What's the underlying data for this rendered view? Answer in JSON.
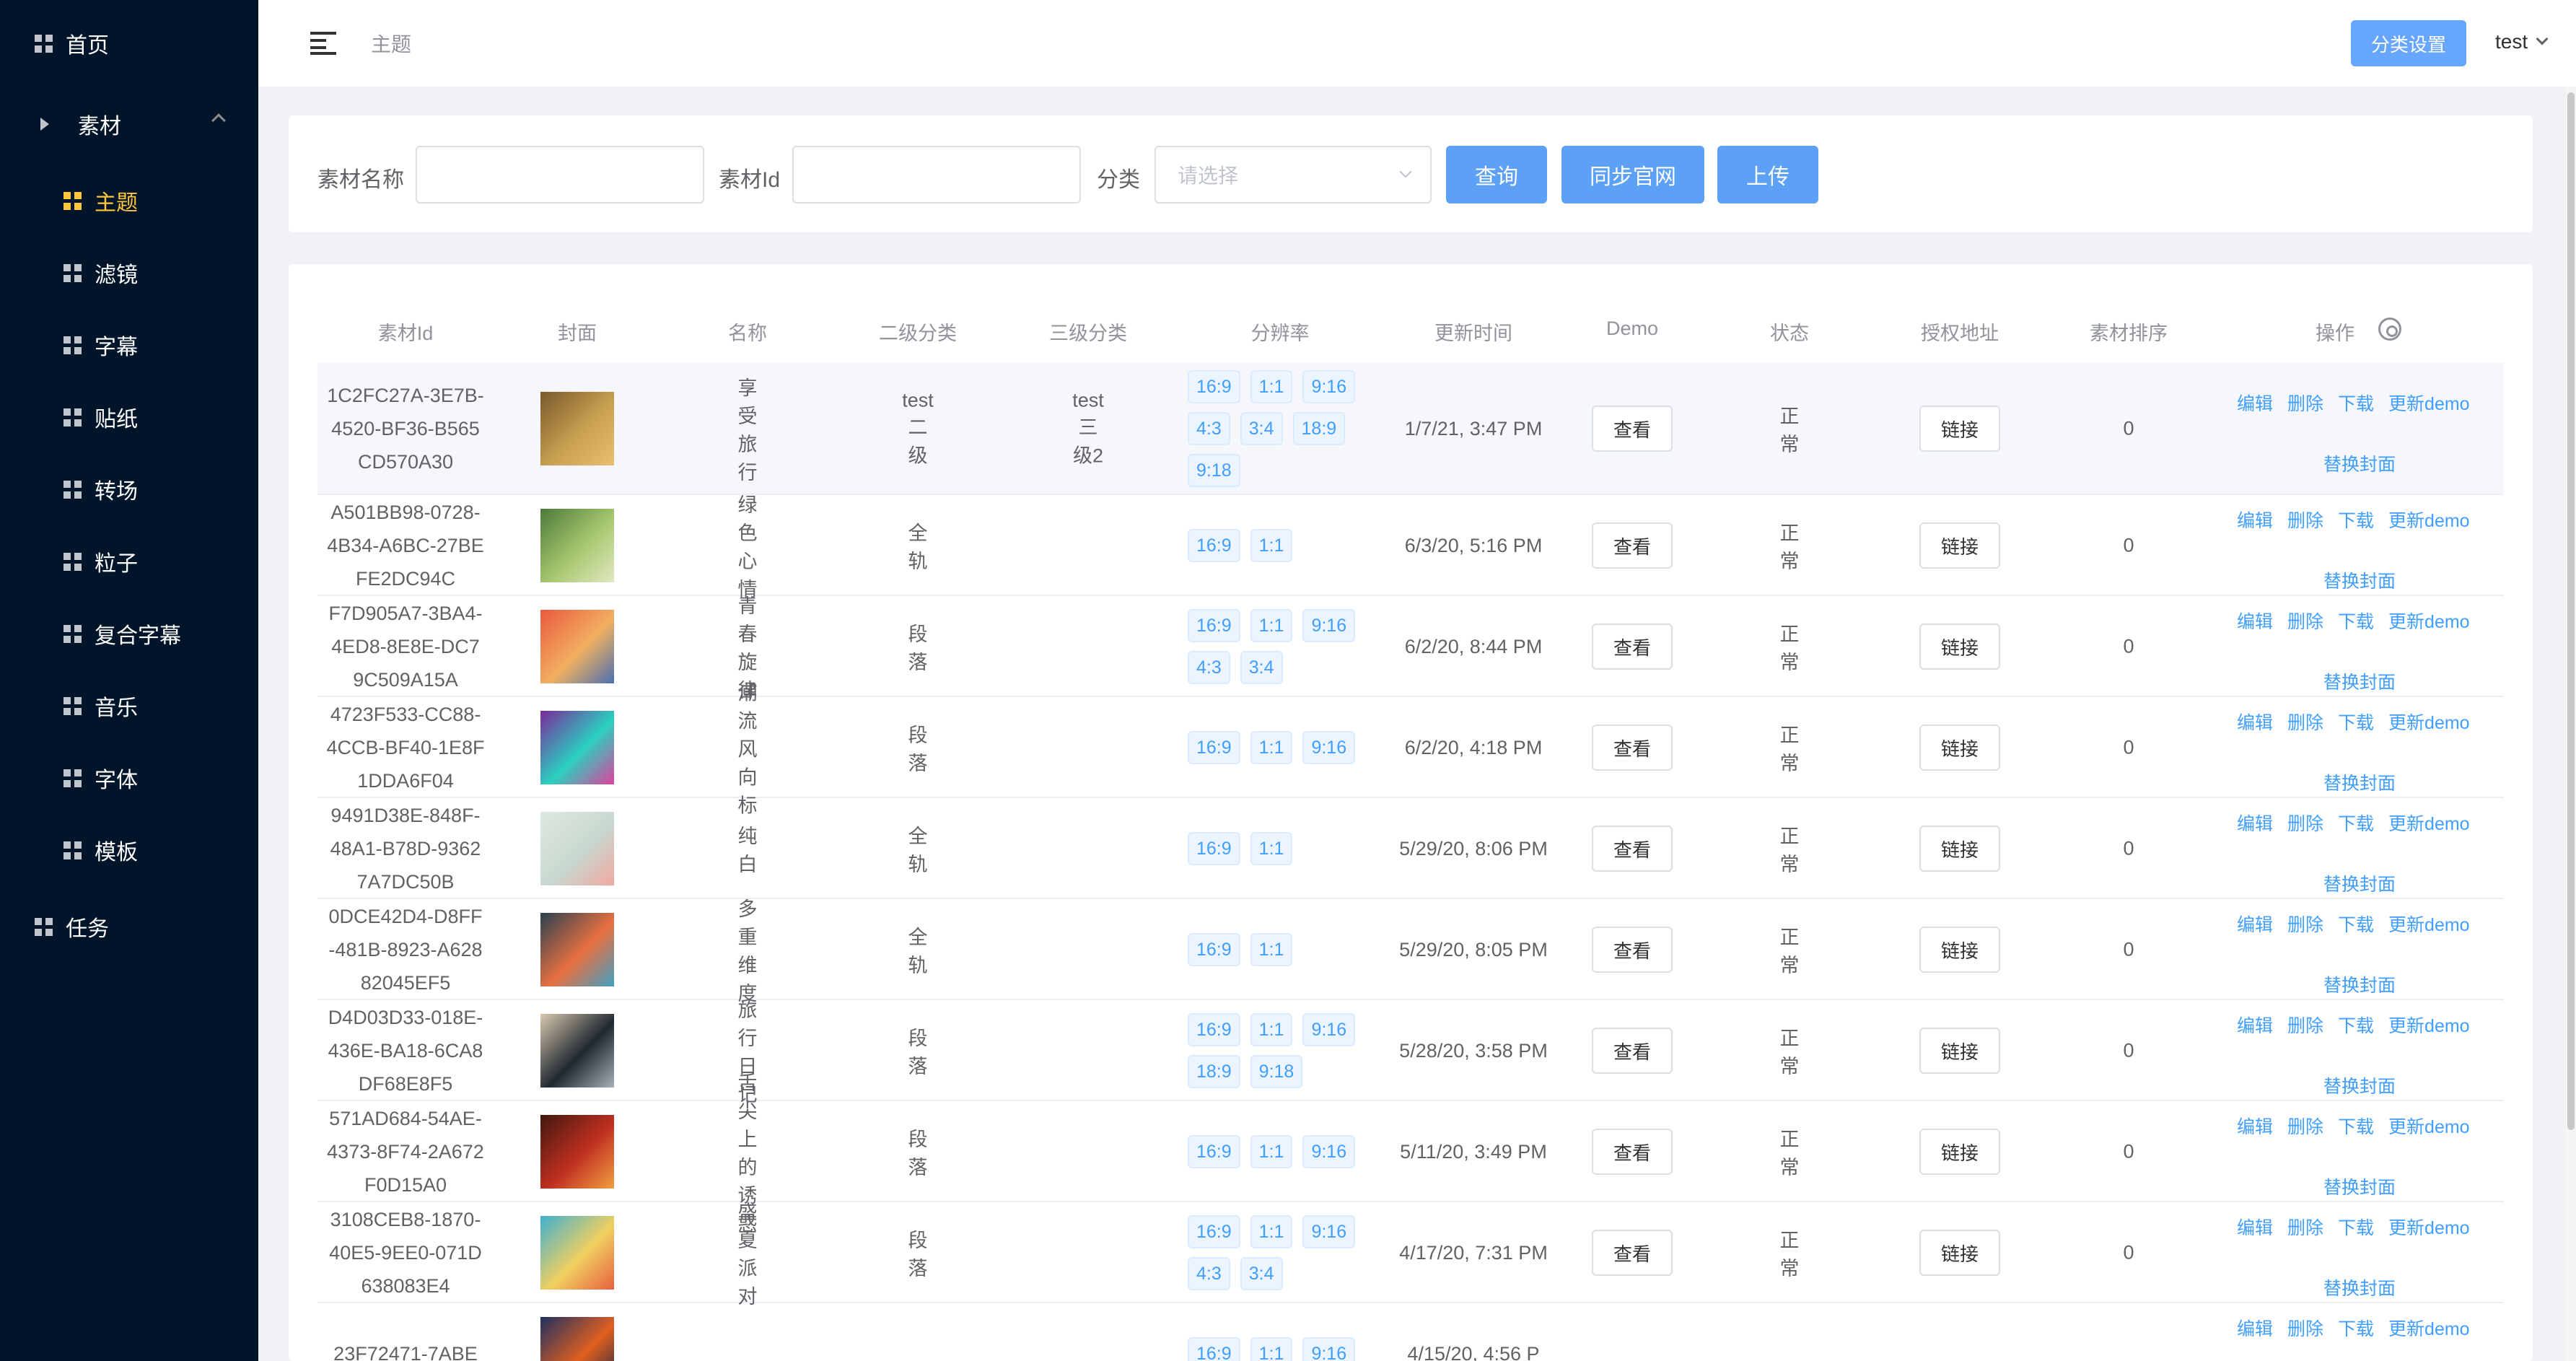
{
  "sidebar": {
    "items": [
      {
        "label": "首页"
      },
      {
        "label": "素材"
      },
      {
        "label": "主题"
      },
      {
        "label": "滤镜"
      },
      {
        "label": "字幕"
      },
      {
        "label": "贴纸"
      },
      {
        "label": "转场"
      },
      {
        "label": "粒子"
      },
      {
        "label": "复合字幕"
      },
      {
        "label": "音乐"
      },
      {
        "label": "字体"
      },
      {
        "label": "模板"
      },
      {
        "label": "任务"
      }
    ]
  },
  "header": {
    "breadcrumb": "主题",
    "category_button": "分类设置",
    "user": "test"
  },
  "search": {
    "name_label": "素材名称",
    "id_label": "素材Id",
    "category_label": "分类",
    "category_placeholder": "请选择",
    "query_button": "查询",
    "sync_button": "同步官网",
    "upload_button": "上传"
  },
  "table": {
    "headers": [
      "素材Id",
      "封面",
      "名称",
      "二级分类",
      "三级分类",
      "分辨率",
      "更新时间",
      "Demo",
      "状态",
      "授权地址",
      "素材排序",
      "操作"
    ],
    "view_label": "查看",
    "link_label": "链接",
    "ops": {
      "edit": "编辑",
      "delete": "删除",
      "download": "下载",
      "update_demo": "更新demo",
      "replace_cover": "替换封面"
    },
    "rows": [
      {
        "id": "1C2FC27A-3E7B-4520-BF36-B565CD570A30",
        "name": "享受旅行",
        "cat2": "test二级",
        "cat3": "test三级2",
        "ratios": [
          "16:9",
          "1:1",
          "9:16",
          "4:3",
          "3:4",
          "18:9",
          "9:18"
        ],
        "time": "1/7/21, 3:47 PM",
        "status": "正常",
        "sort": "0"
      },
      {
        "id": "A501BB98-0728-4B34-A6BC-27BEFE2DC94C",
        "name": "绿色心情",
        "cat2": "全轨",
        "cat3": "",
        "ratios": [
          "16:9",
          "1:1"
        ],
        "time": "6/3/20, 5:16 PM",
        "status": "正常",
        "sort": "0"
      },
      {
        "id": "F7D905A7-3BA4-4ED8-8E8E-DC79C509A15A",
        "name": "青春旋律",
        "cat2": "段落",
        "cat3": "",
        "ratios": [
          "16:9",
          "1:1",
          "9:16",
          "4:3",
          "3:4"
        ],
        "time": "6/2/20, 8:44 PM",
        "status": "正常",
        "sort": "0"
      },
      {
        "id": "4723F533-CC88-4CCB-BF40-1E8F1DDA6F04",
        "name": "潮流风向标",
        "cat2": "段落",
        "cat3": "",
        "ratios": [
          "16:9",
          "1:1",
          "9:16"
        ],
        "time": "6/2/20, 4:18 PM",
        "status": "正常",
        "sort": "0"
      },
      {
        "id": "9491D38E-848F-48A1-B78D-93627A7DC50B",
        "name": "纯白",
        "cat2": "全轨",
        "cat3": "",
        "ratios": [
          "16:9",
          "1:1"
        ],
        "time": "5/29/20, 8:06 PM",
        "status": "正常",
        "sort": "0"
      },
      {
        "id": "0DCE42D4-D8FF-481B-8923-A62882045EF5",
        "name": "多重维度",
        "cat2": "全轨",
        "cat3": "",
        "ratios": [
          "16:9",
          "1:1"
        ],
        "time": "5/29/20, 8:05 PM",
        "status": "正常",
        "sort": "0"
      },
      {
        "id": "D4D03D33-018E-436E-BA18-6CA8DF68E8F5",
        "name": "旅行日记",
        "cat2": "段落",
        "cat3": "",
        "ratios": [
          "16:9",
          "1:1",
          "9:16",
          "18:9",
          "9:18"
        ],
        "time": "5/28/20, 3:58 PM",
        "status": "正常",
        "sort": "0"
      },
      {
        "id": "571AD684-54AE-4373-8F74-2A672F0D15A0",
        "name": "舌尖上的诱惑",
        "cat2": "段落",
        "cat3": "",
        "ratios": [
          "16:9",
          "1:1",
          "9:16"
        ],
        "time": "5/11/20, 3:49 PM",
        "status": "正常",
        "sort": "0"
      },
      {
        "id": "3108CEB8-1870-40E5-9EE0-071D638083E4",
        "name": "盛夏派对",
        "cat2": "段落",
        "cat3": "",
        "ratios": [
          "16:9",
          "1:1",
          "9:16",
          "4:3",
          "3:4"
        ],
        "time": "4/17/20, 7:31 PM",
        "status": "正常",
        "sort": "0"
      },
      {
        "id": "23F72471-7ABE",
        "name": "",
        "cat2": "",
        "cat3": "",
        "ratios": [
          "16:9",
          "1:1",
          "9:16"
        ],
        "time": "4/15/20, 4:56 P",
        "status": "",
        "sort": ""
      }
    ]
  },
  "colors": {
    "sidebar_bg": "#001529",
    "active": "#ffc53d",
    "primary": "#5ca1f5",
    "link": "#409eff"
  }
}
